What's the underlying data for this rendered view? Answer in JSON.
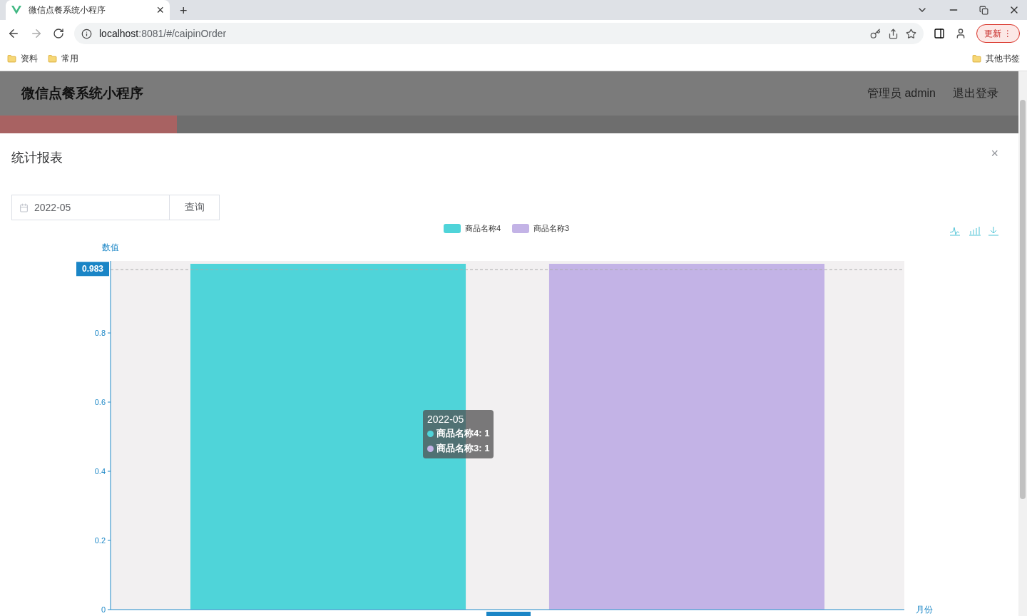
{
  "browser": {
    "tab": {
      "title": "微信点餐系统小程序",
      "close": "×",
      "new_tab": "+"
    },
    "address": {
      "host": "localhost",
      "rest": ":8081/#/caipinOrder"
    },
    "update_button": "更新",
    "menu_button": "⋮",
    "bookmarks": [
      {
        "label": "资料"
      },
      {
        "label": "常用"
      }
    ],
    "other_bookmarks": "其他书签"
  },
  "app_header": {
    "title": "微信点餐系统小程序",
    "user": "管理员 admin",
    "logout": "退出登录"
  },
  "dialog": {
    "title": "统计报表",
    "close": "×",
    "date_field": {
      "value": "2022-05"
    },
    "query_button": "查询",
    "chart_data": {
      "type": "bar",
      "xlabel": "月份",
      "ylabel": "数值",
      "legend": true,
      "ref_lines": [
        {
          "axis": "y",
          "value": 0.983,
          "label": "0.983"
        }
      ],
      "series": [
        {
          "name": "商品名称4",
          "color": "#4fd4d9",
          "values": [
            1
          ]
        },
        {
          "name": "商品名称3",
          "color": "#c3b3e6",
          "values": [
            1
          ]
        }
      ],
      "ylim": [
        0,
        1
      ],
      "yticks": [
        0,
        0.2,
        0.4,
        0.6,
        0.8
      ]
    },
    "tooltip": {
      "title": "2022-05",
      "rows": [
        {
          "text": "商品名称4: 1",
          "color": "#4fd4d9"
        },
        {
          "text": "商品名称3: 1",
          "color": "#c3b3e6"
        }
      ]
    }
  }
}
